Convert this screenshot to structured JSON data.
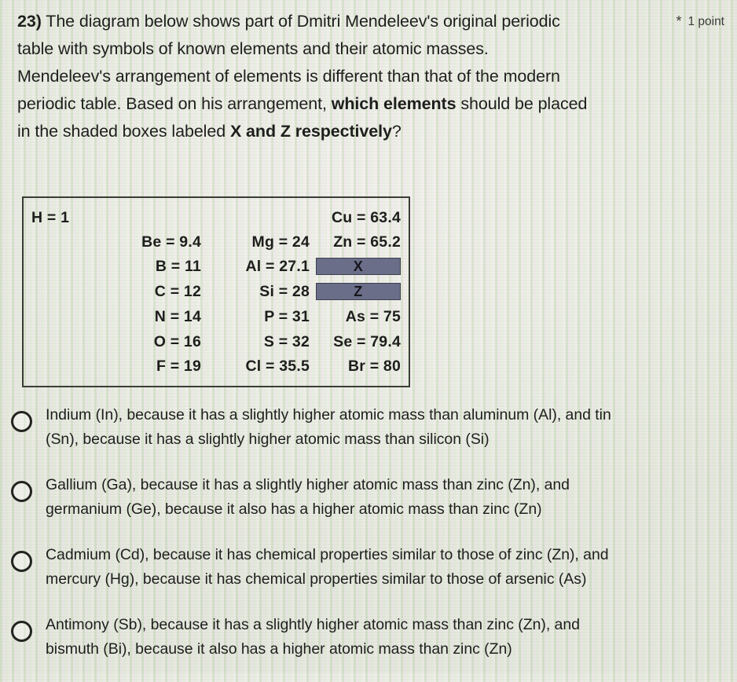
{
  "question": {
    "number": "23)",
    "lines": [
      "The diagram below shows part of Dmitri Mendeleev's original periodic",
      "table with symbols of known elements and their atomic masses.",
      "Mendeleev's arrangement of elements is different than that of the modern",
      "periodic table. Based on his arrangement, ",
      "in the shaded boxes labeled "
    ],
    "bold_line4": "which elements",
    "line4_tail": " should be placed",
    "bold_line5": "X and Z respectively",
    "line5_tail": "?",
    "required_marker": "*",
    "points_label": "1 point"
  },
  "diagram": {
    "name": "mendeleev-periodic-table-excerpt",
    "rows": [
      {
        "col1": "H = 1",
        "col2": "",
        "col3": "",
        "col4": "Cu = 63.4"
      },
      {
        "col1": "",
        "col2": "Be = 9.4",
        "col3": "Mg = 24",
        "col4": "Zn = 65.2"
      },
      {
        "col1": "",
        "col2": "B = 11",
        "col3": "Al = 27.1",
        "col4": "__SHADED_X__"
      },
      {
        "col1": "",
        "col2": "C = 12",
        "col3": "Si = 28",
        "col4": "__SHADED_Z__"
      },
      {
        "col1": "",
        "col2": "N = 14",
        "col3": "P = 31",
        "col4": "As = 75"
      },
      {
        "col1": "",
        "col2": "O = 16",
        "col3": "S = 32",
        "col4": "Se = 79.4"
      },
      {
        "col1": "",
        "col2": "F = 19",
        "col3": "Cl = 35.5",
        "col4": "Br = 80"
      }
    ],
    "shaded_x_label": "X",
    "shaded_z_label": "Z",
    "shade_color": "#6a6e88",
    "border_color": "#3b3d39"
  },
  "options": [
    {
      "id": "option-a",
      "line1": "Indium (In), because it has a slightly higher atomic mass than aluminum (Al), and tin",
      "line2": "(Sn), because it has a slightly higher atomic mass than silicon (Si)",
      "selected": false
    },
    {
      "id": "option-b",
      "line1": "Gallium (Ga), because it has a slightly higher atomic mass than zinc (Zn), and",
      "line2": "germanium (Ge), because it also has a higher atomic mass than zinc (Zn)",
      "selected": false
    },
    {
      "id": "option-c",
      "line1": "Cadmium (Cd), because it has chemical properties similar to those of zinc (Zn), and",
      "line2": "mercury (Hg), because it has chemical properties similar to those of arsenic (As)",
      "selected": false
    },
    {
      "id": "option-d",
      "line1": "Antimony (Sb), because it has a slightly higher atomic mass than zinc (Zn), and",
      "line2": "bismuth (Bi), because it also has a higher atomic mass than zinc (Zn)",
      "selected": false
    }
  ]
}
